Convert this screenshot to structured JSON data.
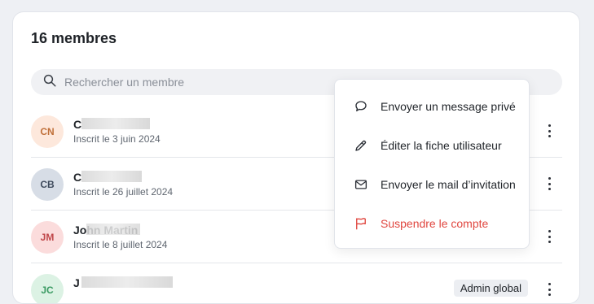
{
  "header": {
    "title": "16 membres"
  },
  "search": {
    "placeholder": "Rechercher un membre",
    "icon": "search-icon"
  },
  "members": [
    {
      "initials": "CN",
      "name_visible": "C",
      "joined": "Inscrit le 3 juin 2024",
      "avatar_bg": "#fde8dc",
      "avatar_fg": "#c0703a"
    },
    {
      "initials": "CB",
      "name_visible": "C",
      "joined": "Inscrit le 26 juillet 2024",
      "avatar_bg": "#d7dde6",
      "avatar_fg": "#3e4a5c"
    },
    {
      "initials": "JM",
      "name_visible": "John Martin",
      "joined": "Inscrit le 8 juillet 2024",
      "avatar_bg": "#fbdcdc",
      "avatar_fg": "#c0474a"
    },
    {
      "initials": "JC",
      "name_visible": "J",
      "joined": "",
      "avatar_bg": "#dcf2e4",
      "avatar_fg": "#3a9a62",
      "badge": "Admin global"
    }
  ],
  "menu": {
    "items": [
      {
        "label": "Envoyer un message privé",
        "icon": "chat-bubble-icon",
        "color": "#1f2328"
      },
      {
        "label": "Éditer la fiche utilisateur",
        "icon": "pencil-icon",
        "color": "#1f2328"
      },
      {
        "label": "Envoyer le mail d’invitation",
        "icon": "envelope-icon",
        "color": "#1f2328"
      },
      {
        "label": "Suspendre le compte",
        "icon": "flag-icon",
        "color": "#e0463f"
      }
    ]
  },
  "colors": {
    "danger": "#e0463f",
    "text": "#1f2328",
    "muted": "#5f6670"
  }
}
